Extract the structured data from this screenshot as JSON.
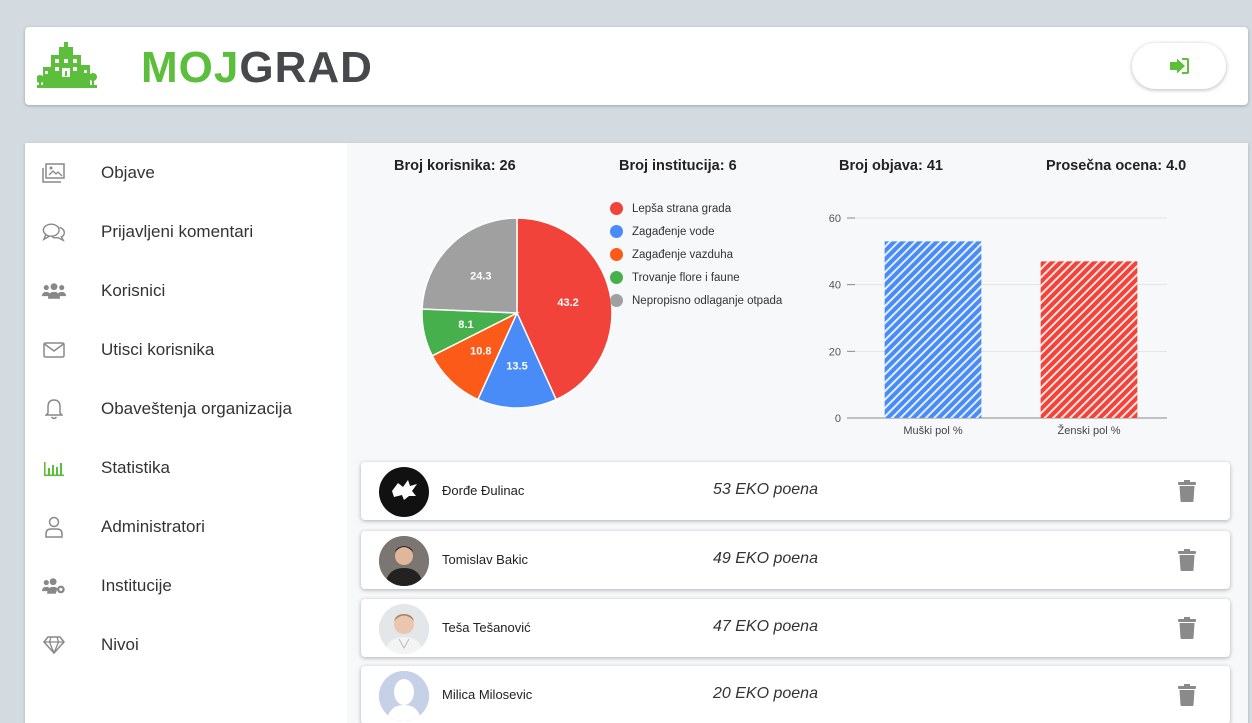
{
  "brand": {
    "part1": "MOJ",
    "part2": "GRAD"
  },
  "header": {
    "logout_icon": "sign-out-icon"
  },
  "sidebar": {
    "items": [
      {
        "label": "Objave",
        "icon": "images-icon"
      },
      {
        "label": "Prijavljeni komentari",
        "icon": "comments-icon"
      },
      {
        "label": "Korisnici",
        "icon": "users-icon"
      },
      {
        "label": "Utisci korisnika",
        "icon": "envelope-icon"
      },
      {
        "label": "Obaveštenja organizacija",
        "icon": "bell-icon"
      },
      {
        "label": "Statistika",
        "icon": "bar-chart-icon",
        "active": true
      },
      {
        "label": "Administratori",
        "icon": "user-icon"
      },
      {
        "label": "Institucije",
        "icon": "users-cog-icon"
      },
      {
        "label": "Nivoi",
        "icon": "gem-icon"
      }
    ]
  },
  "stats": {
    "users": "Broj korisnika: 26",
    "institutions": "Broj institucija: 6",
    "posts": "Broj objava: 41",
    "rating": "Prosečna ocena: 4.0"
  },
  "colors": {
    "brand_green": "#5cbf3c",
    "brand_dark": "#45494c",
    "red": "#f2433a",
    "blue": "#4a8cf7",
    "orange": "#fb5a18",
    "green": "#45b04c",
    "gray": "#a0a0a0"
  },
  "chart_data": [
    {
      "type": "pie",
      "categories": [
        "Lepša strana grada",
        "Zagađenje vode",
        "Zagađenje vazduha",
        "Trovanje flore i faune",
        "Nepropisno odlaganje otpada"
      ],
      "values": [
        43.2,
        13.5,
        10.8,
        8.1,
        24.3
      ],
      "colors": [
        "#f2433a",
        "#4a8cf7",
        "#fb5a18",
        "#45b04c",
        "#a0a0a0"
      ],
      "legend": "right"
    },
    {
      "type": "bar",
      "categories": [
        "Muški pol %",
        "Ženski pol %"
      ],
      "values": [
        53,
        47
      ],
      "colors": [
        "#4a8cf7",
        "#f2433a"
      ],
      "ylim": [
        0,
        60
      ],
      "yticks": [
        0,
        20,
        40,
        60
      ],
      "grid": true,
      "pattern": "diagonal-hatch"
    }
  ],
  "leaderboard": [
    {
      "name": "Đorđe Đulinac",
      "points": "53 EKO poena",
      "avatar": "splat-logo"
    },
    {
      "name": "Tomislav Bakic",
      "points": "49 EKO poena",
      "avatar": "photo"
    },
    {
      "name": "Teša Tešanović",
      "points": "47 EKO poena",
      "avatar": "photo"
    },
    {
      "name": "Milica Milosevic",
      "points": "20 EKO poena",
      "avatar": "default"
    }
  ]
}
